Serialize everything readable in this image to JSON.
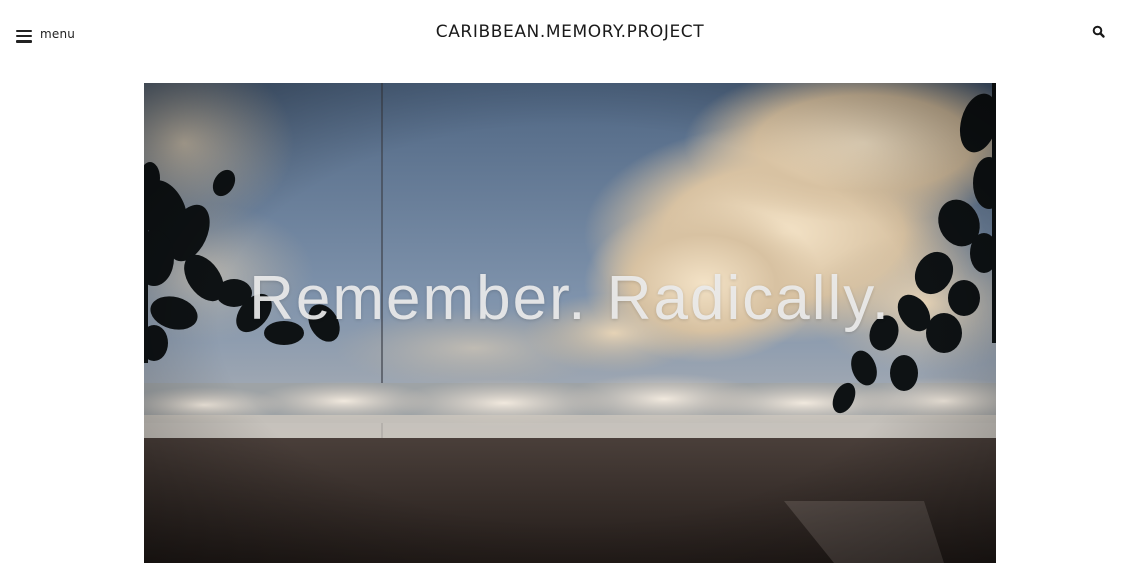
{
  "header": {
    "menu_label": "menu",
    "site_title": "CARIBBEAN.MEMORY.PROJECT",
    "menu_icon": "hamburger-icon",
    "search_icon": "search-icon"
  },
  "hero": {
    "headline": "Remember. Radically."
  },
  "colors": {
    "background": "#ffffff",
    "text": "#1a1a1a",
    "sky_top": "#5f7591",
    "sand": "#2d2522"
  }
}
